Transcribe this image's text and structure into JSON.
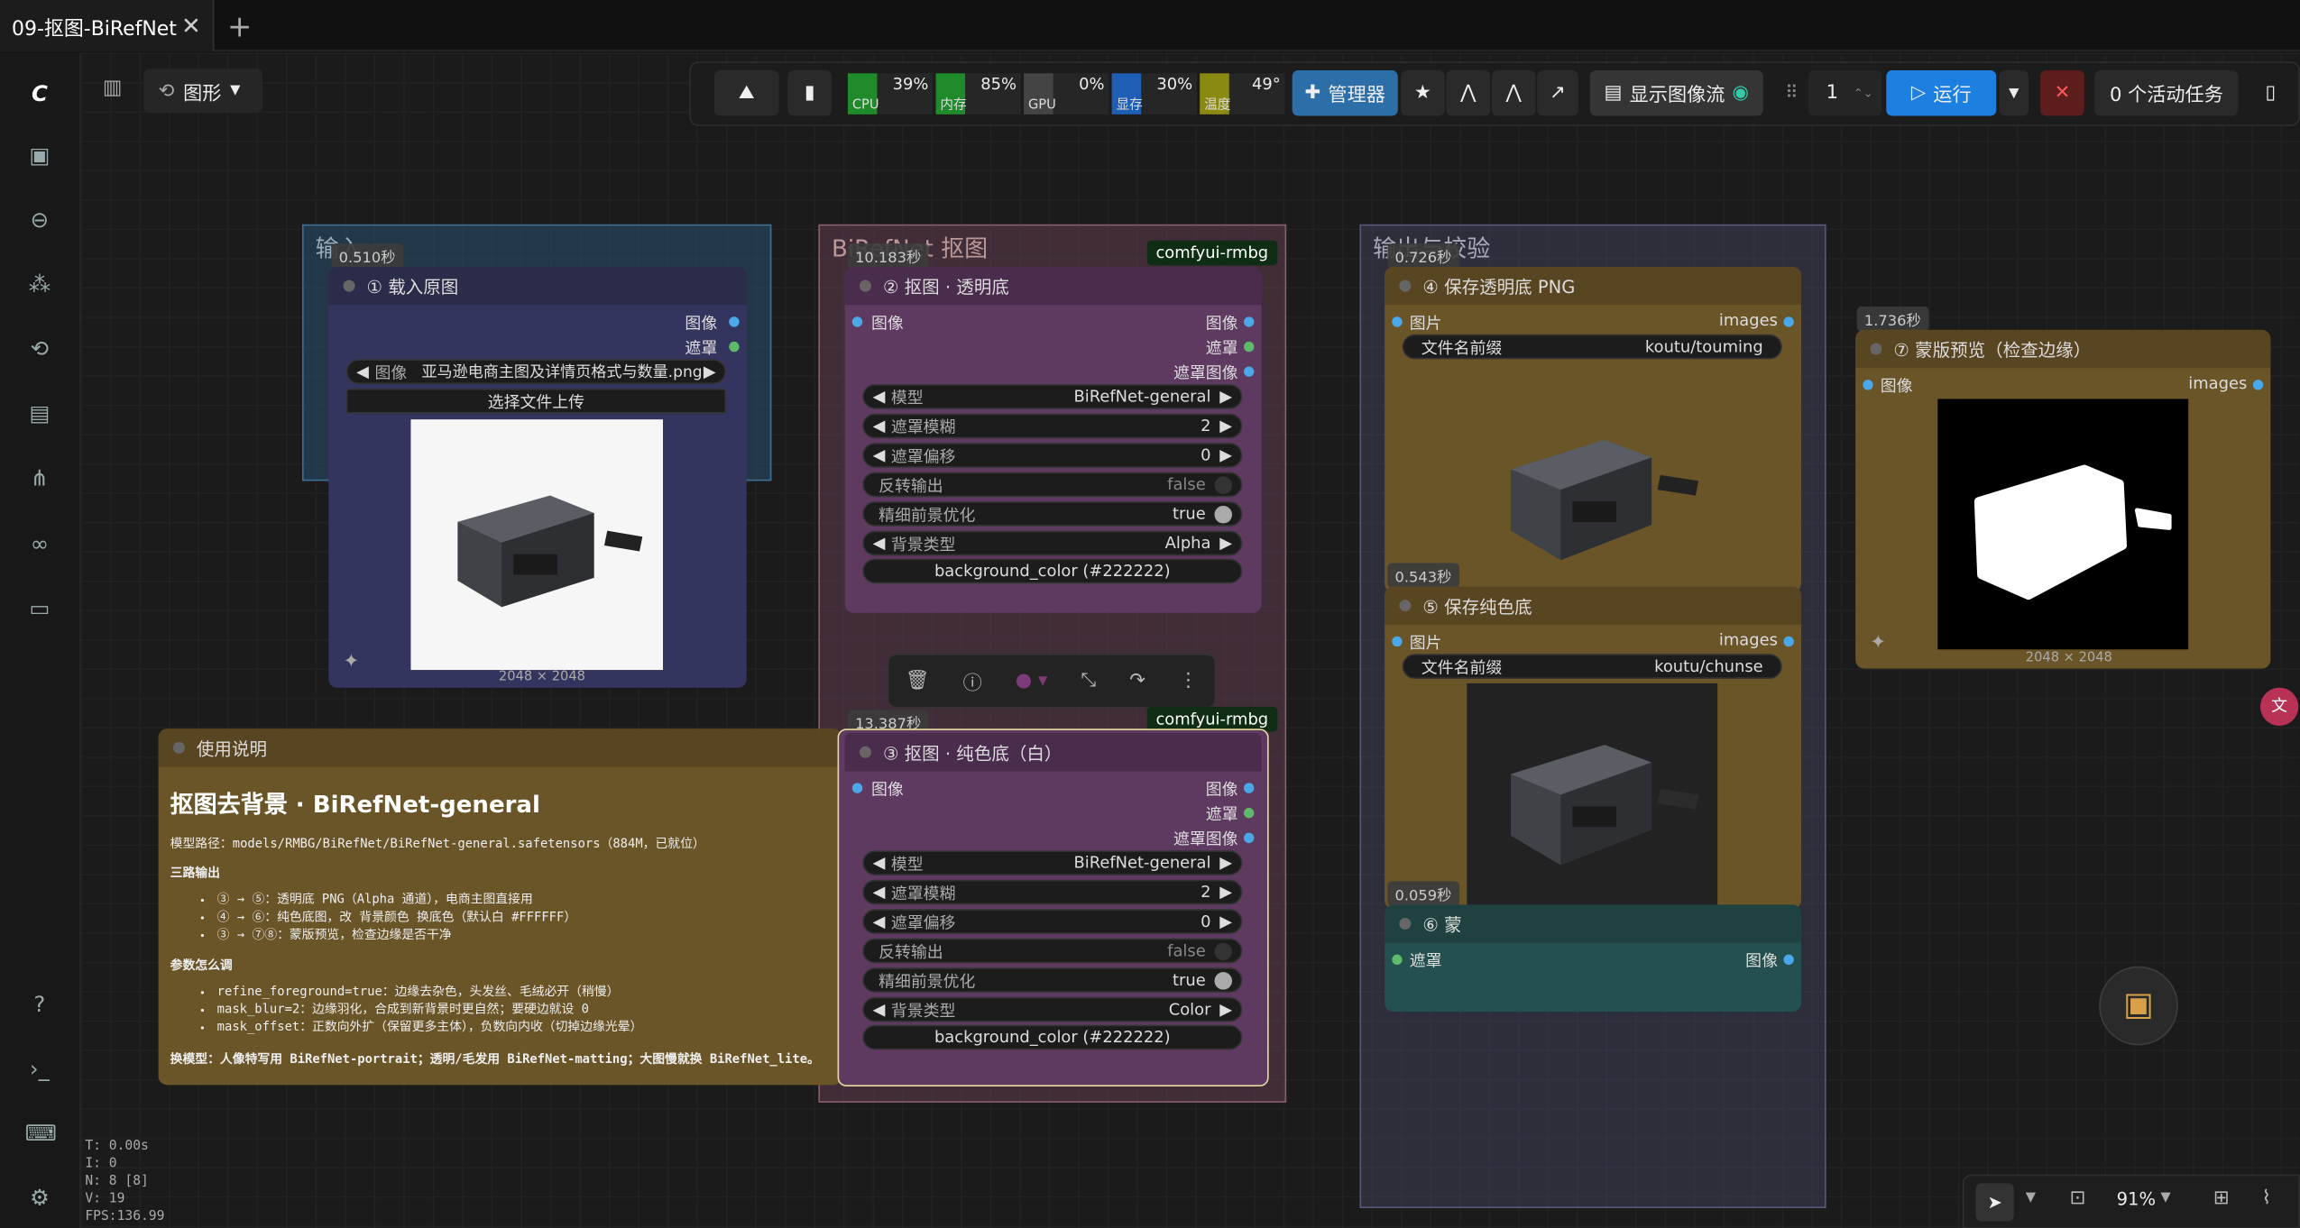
{
  "tab": {
    "title": "09-抠图-BiRefNet"
  },
  "topbar": {
    "graph_label": "图形",
    "meters": [
      {
        "label": "CPU",
        "value": "39%",
        "color": "#1f8a2a"
      },
      {
        "label": "内存",
        "value": "85%",
        "color": "#1f8a2a"
      },
      {
        "label": "GPU",
        "value": "0%",
        "color": "#444"
      },
      {
        "label": "显存",
        "value": "30%",
        "color": "#1e5fb5"
      },
      {
        "label": "温度",
        "value": "49°",
        "color": "#8a8a12"
      }
    ],
    "manager": "管理器",
    "show_stream": "显示图像流",
    "queue_count": "1",
    "run": "运行",
    "active_tasks": "0 个活动任务"
  },
  "groups": {
    "input": "输入",
    "birefnet": "BiRefNet 抠图",
    "output": "输出与校验"
  },
  "nodes": {
    "n1": {
      "time": "0.510秒",
      "title": "① 载入原图",
      "out1": "图像",
      "out2": "遮罩",
      "image_label": "图像",
      "image_value": "亚马逊电商主图及详情页格式与数量.png",
      "upload": "选择文件上传",
      "dims": "2048 × 2048"
    },
    "n2": {
      "time": "10.183秒",
      "tag": "comfyui-rmbg",
      "title": "② 抠图 · 透明底",
      "in1": "图像",
      "out1": "图像",
      "out2": "遮罩",
      "out3": "遮罩图像",
      "w": [
        {
          "l": "模型",
          "r": "BiRefNet-general"
        },
        {
          "l": "遮罩模糊",
          "r": "2"
        },
        {
          "l": "遮罩偏移",
          "r": "0"
        },
        {
          "l": "反转输出",
          "r": "false"
        },
        {
          "l": "精细前景优化",
          "r": "true"
        },
        {
          "l": "背景类型",
          "r": "Alpha"
        }
      ],
      "bg": "background_color (#222222)"
    },
    "n3": {
      "time": "13.387秒",
      "tag": "comfyui-rmbg",
      "title": "③ 抠图 · 纯色底（白）",
      "in1": "图像",
      "out1": "图像",
      "out2": "遮罩",
      "out3": "遮罩图像",
      "w": [
        {
          "l": "模型",
          "r": "BiRefNet-general"
        },
        {
          "l": "遮罩模糊",
          "r": "2"
        },
        {
          "l": "遮罩偏移",
          "r": "0"
        },
        {
          "l": "反转输出",
          "r": "false"
        },
        {
          "l": "精细前景优化",
          "r": "true"
        },
        {
          "l": "背景类型",
          "r": "Color"
        }
      ],
      "bg": "background_color (#222222)"
    },
    "n4": {
      "time": "0.726秒",
      "title": "④ 保存透明底 PNG",
      "in1": "图片",
      "out1": "images",
      "prefix_l": "文件名前缀",
      "prefix_v": "koutu/touming"
    },
    "n5": {
      "time": "0.543秒",
      "title": "⑤ 保存纯色底",
      "in1": "图片",
      "out1": "images",
      "prefix_l": "文件名前缀",
      "prefix_v": "koutu/chunse"
    },
    "n6": {
      "time": "0.059秒",
      "title": "⑥ 蒙",
      "in1": "遮罩",
      "out1": "图像"
    },
    "n7": {
      "time": "1.736秒",
      "title": "⑦ 蒙版预览（检查边缘）",
      "in1": "图像",
      "out1": "images",
      "dims": "2048 × 2048"
    }
  },
  "notes": {
    "header": "使用说明",
    "title": "抠图去背景 · BiRefNet-general",
    "path": "模型路径：models/RMBG/BiRefNet/BiRefNet-general.safetensors（884M，已就位）",
    "h1": "三路输出",
    "b1": [
      "③ → ⑤：透明底 PNG（Alpha 通道），电商主图直接用",
      "④ → ⑥：纯色底图，改 背景颜色 换底色（默认白 #FFFFFF）",
      "③ → ⑦⑧：蒙版预览，检查边缘是否干净"
    ],
    "h2": "参数怎么调",
    "b2": [
      "refine_foreground=true：边缘去杂色，头发丝、毛绒必开（稍慢）",
      "mask_blur=2：边缘羽化，合成到新背景时更自然；要硬边就设 0",
      "mask_offset：正数向外扩（保留更多主体），负数向内收（切掉边缘光晕）"
    ],
    "footer": "换模型：人像特写用 BiRefNet-portrait；透明/毛发用 BiRefNet-matting；大图慢就换 BiRefNet_lite。"
  },
  "stats": {
    "t": "T: 0.00s",
    "i": "I: 0",
    "n": "N: 8 [8]",
    "v": "V: 19",
    "fps": "FPS:136.99"
  },
  "zoom": "91%"
}
